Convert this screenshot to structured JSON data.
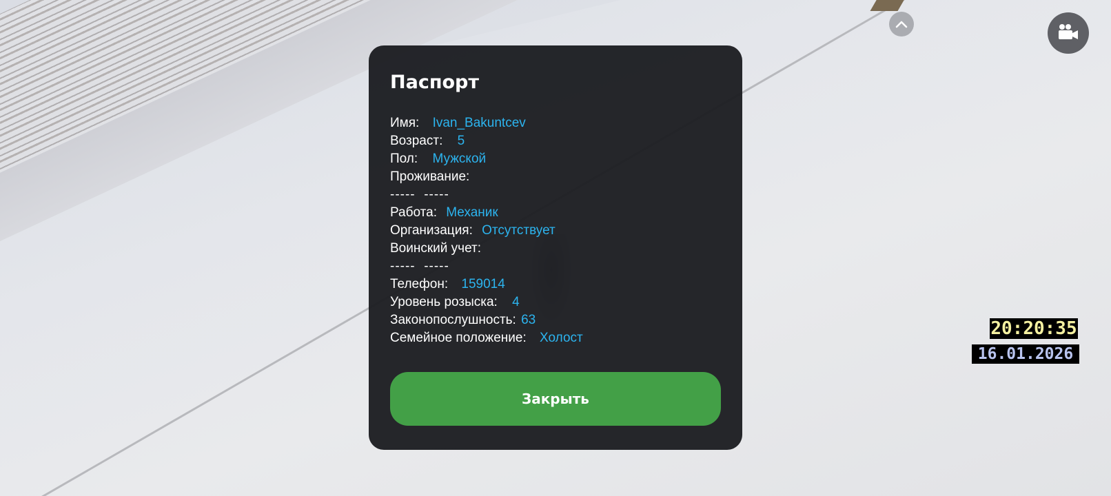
{
  "passport": {
    "title": "Паспорт",
    "rows": [
      {
        "label": "Имя:",
        "value": "Ivan_Bakuntcev"
      },
      {
        "label": "Возраст:",
        "value": "5"
      },
      {
        "label": "Пол:",
        "value": "Мужской"
      },
      {
        "label": "Проживание:",
        "value": ""
      },
      {
        "label": "",
        "value": "-----  -----"
      },
      {
        "label": "Работа:",
        "value": "Механик"
      },
      {
        "label": "Организация:",
        "value": "Отсутствует"
      },
      {
        "label": "Воинский учет:",
        "value": ""
      },
      {
        "label": "",
        "value": "-----  -----"
      },
      {
        "label": "Телефон:",
        "value": "159014"
      },
      {
        "label": "Уровень розыска:",
        "value": "4"
      },
      {
        "label": "Законопослушность:",
        "value": "63"
      },
      {
        "label": "Семейное положение:",
        "value": "Холост"
      }
    ],
    "close_label": "Закрыть"
  },
  "hud": {
    "time": "20:20:35",
    "date": "16.01.2026"
  },
  "icons": {
    "arrow": "chevron-up-icon",
    "camera": "video-camera-icon"
  },
  "colors": {
    "card_bg": "#1e1f23",
    "value_text": "#2cb4ef",
    "close_button": "#43a047",
    "time_text": "#f4f0a0",
    "date_text": "#b9c4ef"
  }
}
